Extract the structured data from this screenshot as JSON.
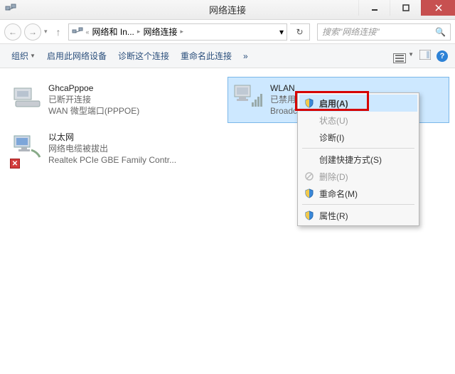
{
  "window": {
    "title": "网络连接"
  },
  "address": {
    "crumb1": "网络和 In...",
    "crumb2": "网络连接"
  },
  "search": {
    "placeholder": "搜索\"网络连接\""
  },
  "toolbar": {
    "organize": "组织",
    "enable_device": "启用此网络设备",
    "diagnose": "诊断这个连接",
    "rename": "重命名此连接",
    "overflow": "»"
  },
  "connections": [
    {
      "name": "GhcaPppoe",
      "status": "已断开连接",
      "device": "WAN 微型端口(PPPOE)"
    },
    {
      "name": "以太网",
      "status": "网络电缆被拔出",
      "device": "Realtek PCIe GBE Family Contr..."
    },
    {
      "name": "WLAN",
      "status": "已禁用",
      "device": "Broadcom"
    }
  ],
  "context_menu": {
    "enable": "启用(A)",
    "status": "状态(U)",
    "diagnose": "诊断(I)",
    "create_shortcut": "创建快捷方式(S)",
    "delete": "删除(D)",
    "rename": "重命名(M)",
    "properties": "属性(R)"
  }
}
